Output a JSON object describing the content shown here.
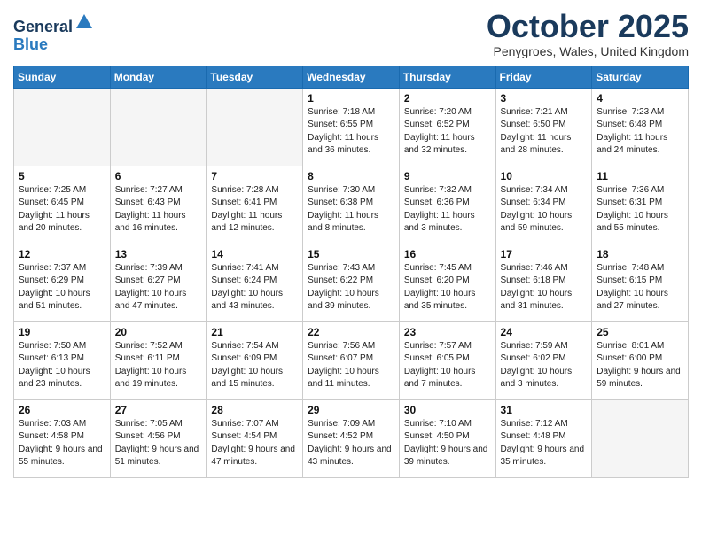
{
  "logo": {
    "general": "General",
    "blue": "Blue"
  },
  "header": {
    "month": "October 2025",
    "location": "Penygroes, Wales, United Kingdom"
  },
  "weekdays": [
    "Sunday",
    "Monday",
    "Tuesday",
    "Wednesday",
    "Thursday",
    "Friday",
    "Saturday"
  ],
  "weeks": [
    [
      {
        "day": "",
        "text": ""
      },
      {
        "day": "",
        "text": ""
      },
      {
        "day": "",
        "text": ""
      },
      {
        "day": "1",
        "text": "Sunrise: 7:18 AM\nSunset: 6:55 PM\nDaylight: 11 hours\nand 36 minutes."
      },
      {
        "day": "2",
        "text": "Sunrise: 7:20 AM\nSunset: 6:52 PM\nDaylight: 11 hours\nand 32 minutes."
      },
      {
        "day": "3",
        "text": "Sunrise: 7:21 AM\nSunset: 6:50 PM\nDaylight: 11 hours\nand 28 minutes."
      },
      {
        "day": "4",
        "text": "Sunrise: 7:23 AM\nSunset: 6:48 PM\nDaylight: 11 hours\nand 24 minutes."
      }
    ],
    [
      {
        "day": "5",
        "text": "Sunrise: 7:25 AM\nSunset: 6:45 PM\nDaylight: 11 hours\nand 20 minutes."
      },
      {
        "day": "6",
        "text": "Sunrise: 7:27 AM\nSunset: 6:43 PM\nDaylight: 11 hours\nand 16 minutes."
      },
      {
        "day": "7",
        "text": "Sunrise: 7:28 AM\nSunset: 6:41 PM\nDaylight: 11 hours\nand 12 minutes."
      },
      {
        "day": "8",
        "text": "Sunrise: 7:30 AM\nSunset: 6:38 PM\nDaylight: 11 hours\nand 8 minutes."
      },
      {
        "day": "9",
        "text": "Sunrise: 7:32 AM\nSunset: 6:36 PM\nDaylight: 11 hours\nand 3 minutes."
      },
      {
        "day": "10",
        "text": "Sunrise: 7:34 AM\nSunset: 6:34 PM\nDaylight: 10 hours\nand 59 minutes."
      },
      {
        "day": "11",
        "text": "Sunrise: 7:36 AM\nSunset: 6:31 PM\nDaylight: 10 hours\nand 55 minutes."
      }
    ],
    [
      {
        "day": "12",
        "text": "Sunrise: 7:37 AM\nSunset: 6:29 PM\nDaylight: 10 hours\nand 51 minutes."
      },
      {
        "day": "13",
        "text": "Sunrise: 7:39 AM\nSunset: 6:27 PM\nDaylight: 10 hours\nand 47 minutes."
      },
      {
        "day": "14",
        "text": "Sunrise: 7:41 AM\nSunset: 6:24 PM\nDaylight: 10 hours\nand 43 minutes."
      },
      {
        "day": "15",
        "text": "Sunrise: 7:43 AM\nSunset: 6:22 PM\nDaylight: 10 hours\nand 39 minutes."
      },
      {
        "day": "16",
        "text": "Sunrise: 7:45 AM\nSunset: 6:20 PM\nDaylight: 10 hours\nand 35 minutes."
      },
      {
        "day": "17",
        "text": "Sunrise: 7:46 AM\nSunset: 6:18 PM\nDaylight: 10 hours\nand 31 minutes."
      },
      {
        "day": "18",
        "text": "Sunrise: 7:48 AM\nSunset: 6:15 PM\nDaylight: 10 hours\nand 27 minutes."
      }
    ],
    [
      {
        "day": "19",
        "text": "Sunrise: 7:50 AM\nSunset: 6:13 PM\nDaylight: 10 hours\nand 23 minutes."
      },
      {
        "day": "20",
        "text": "Sunrise: 7:52 AM\nSunset: 6:11 PM\nDaylight: 10 hours\nand 19 minutes."
      },
      {
        "day": "21",
        "text": "Sunrise: 7:54 AM\nSunset: 6:09 PM\nDaylight: 10 hours\nand 15 minutes."
      },
      {
        "day": "22",
        "text": "Sunrise: 7:56 AM\nSunset: 6:07 PM\nDaylight: 10 hours\nand 11 minutes."
      },
      {
        "day": "23",
        "text": "Sunrise: 7:57 AM\nSunset: 6:05 PM\nDaylight: 10 hours\nand 7 minutes."
      },
      {
        "day": "24",
        "text": "Sunrise: 7:59 AM\nSunset: 6:02 PM\nDaylight: 10 hours\nand 3 minutes."
      },
      {
        "day": "25",
        "text": "Sunrise: 8:01 AM\nSunset: 6:00 PM\nDaylight: 9 hours\nand 59 minutes."
      }
    ],
    [
      {
        "day": "26",
        "text": "Sunrise: 7:03 AM\nSunset: 4:58 PM\nDaylight: 9 hours\nand 55 minutes."
      },
      {
        "day": "27",
        "text": "Sunrise: 7:05 AM\nSunset: 4:56 PM\nDaylight: 9 hours\nand 51 minutes."
      },
      {
        "day": "28",
        "text": "Sunrise: 7:07 AM\nSunset: 4:54 PM\nDaylight: 9 hours\nand 47 minutes."
      },
      {
        "day": "29",
        "text": "Sunrise: 7:09 AM\nSunset: 4:52 PM\nDaylight: 9 hours\nand 43 minutes."
      },
      {
        "day": "30",
        "text": "Sunrise: 7:10 AM\nSunset: 4:50 PM\nDaylight: 9 hours\nand 39 minutes."
      },
      {
        "day": "31",
        "text": "Sunrise: 7:12 AM\nSunset: 4:48 PM\nDaylight: 9 hours\nand 35 minutes."
      },
      {
        "day": "",
        "text": ""
      }
    ]
  ]
}
